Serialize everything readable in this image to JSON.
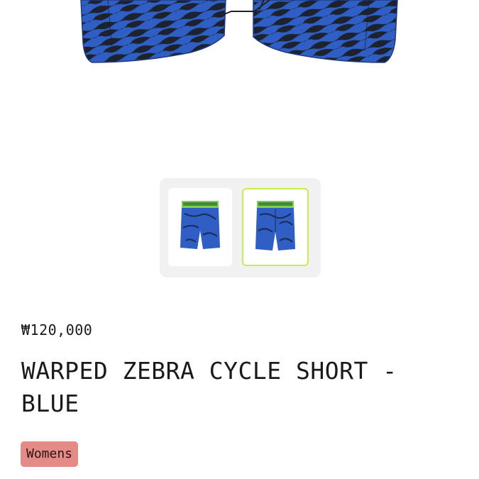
{
  "colors": {
    "accent": "#c6ef4a",
    "tag_background": "#e58b87",
    "product_blue": "#2f5fc4"
  },
  "hero": {
    "image_name": "warped-zebra-cycle-short-blue-main"
  },
  "gallery": {
    "thumbnails": [
      {
        "name": "thumbnail-1",
        "selected": false
      },
      {
        "name": "thumbnail-2",
        "selected": true
      }
    ]
  },
  "product": {
    "price": "₩120,000",
    "title": "WARPED ZEBRA CYCLE SHORT - BLUE",
    "tag": "Womens"
  }
}
